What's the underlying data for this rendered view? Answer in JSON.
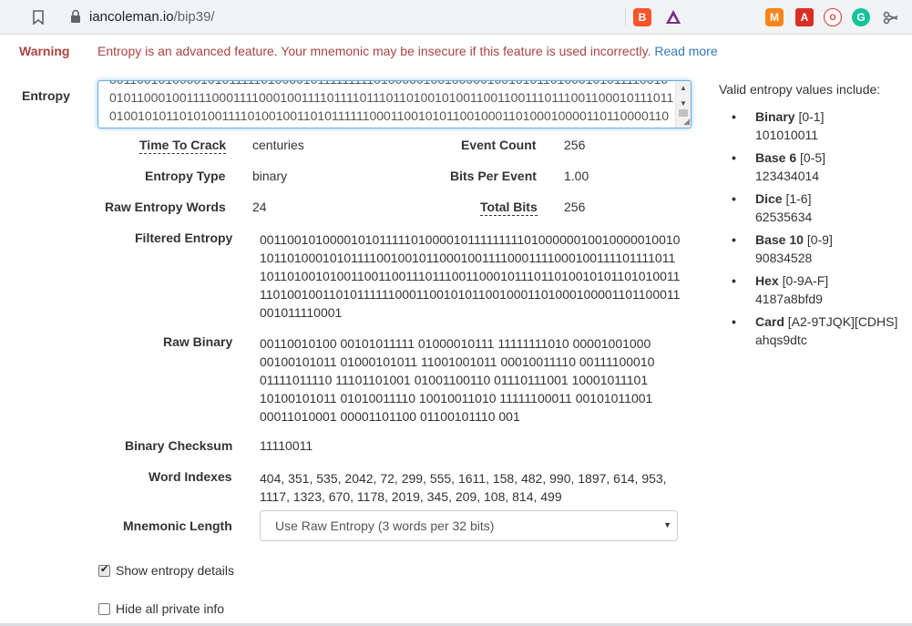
{
  "browser": {
    "url_host": "iancoleman.io",
    "url_path": "/bip39/"
  },
  "warning": {
    "label": "Warning",
    "text": "Entropy is an advanced feature. Your mnemonic may be insecure if this feature is used incorrectly.",
    "link": "Read more"
  },
  "entropy": {
    "label": "Entropy",
    "value": "00110010100001010111110100001011111111101000001001000001001010110100010101111001001011000100111100011110001001111011110111011010010100110011001110111001100010111011010010101101010011110100100110101111110001100101011001000110100010000110110000110010111000111"
  },
  "stats": {
    "time_to_crack_label": "Time To Crack",
    "time_to_crack": "centuries",
    "event_count_label": "Event Count",
    "event_count": "256",
    "entropy_type_label": "Entropy Type",
    "entropy_type": "binary",
    "bits_per_event_label": "Bits Per Event",
    "bits_per_event": "1.00",
    "raw_words_label": "Raw Entropy Words",
    "raw_words": "24",
    "total_bits_label": "Total Bits",
    "total_bits": "256"
  },
  "filtered": {
    "label": "Filtered Entropy",
    "value": "0011001010000101011111010000101111111110100000010010000010010101101000101011110010010110001001111000111100010011110111101110110100101001100110011101110011000101110110100101011010100111101001001101011111100011001010110010001101000100001101100011001011110001"
  },
  "raw_binary": {
    "label": "Raw Binary",
    "value": "00110010100 00101011111 01000010111 11111111010 00001001000 00100101011 01000101011 11001001011 00010011110 00111100010 01111011110 11101101001 01001100110 01110111001 10001011101 10100101011 01010011110 10010011010 11111100011 00101011001 00011010001 00001101100 01100101110 001"
  },
  "checksum": {
    "label": "Binary Checksum",
    "value": "11110011"
  },
  "word_indexes": {
    "label": "Word Indexes",
    "value": "404, 351, 535, 2042, 72, 299, 555, 1611, 158, 482, 990, 1897, 614, 953, 1117, 1323, 670, 1178, 2019, 345, 209, 108, 814, 499"
  },
  "mnemonic_length": {
    "label": "Mnemonic Length",
    "selected": "Use Raw Entropy (3 words per 32 bits)"
  },
  "options": {
    "show_details": "Show entropy details",
    "hide_private": "Hide all private info"
  },
  "side": {
    "title": "Valid entropy values include:",
    "items": [
      {
        "name": "Binary",
        "range": "[0-1]",
        "example": "101010011"
      },
      {
        "name": "Base 6",
        "range": "[0-5]",
        "example": "123434014"
      },
      {
        "name": "Dice",
        "range": "[1-6]",
        "example": "62535634"
      },
      {
        "name": "Base 10",
        "range": "[0-9]",
        "example": "90834528"
      },
      {
        "name": "Hex",
        "range": "[0-9A-F]",
        "example": "4187a8bfd9"
      },
      {
        "name": "Card",
        "range": "[A2-9TJQK][CDHS]",
        "example": "ahqs9dtc"
      }
    ]
  }
}
